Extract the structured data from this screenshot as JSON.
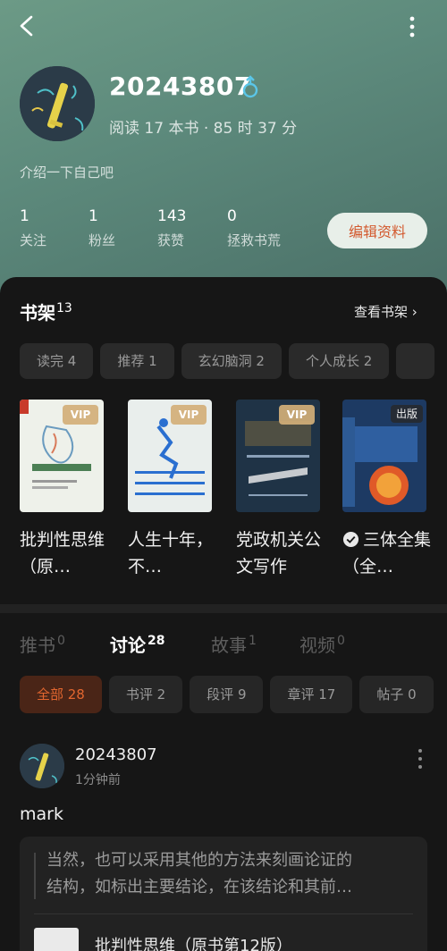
{
  "profile": {
    "username": "20243807",
    "reading_summary": "阅读 17 本书 · 85 时 37 分",
    "intro": "介绍一下自己吧",
    "stats": [
      {
        "value": "1",
        "label": "关注"
      },
      {
        "value": "1",
        "label": "粉丝"
      },
      {
        "value": "143",
        "label": "获赞"
      },
      {
        "value": "0",
        "label": "拯救书荒"
      }
    ],
    "edit_label": "编辑资料",
    "accent_color": "#d35a2f"
  },
  "shelf": {
    "title": "书架",
    "count": "13",
    "view_label": "查看书架 ›",
    "chips": [
      "读完 4",
      "推荐 1",
      "玄幻脑洞 2",
      "个人成长 2"
    ],
    "books": [
      {
        "title": "批判性思维（原…",
        "cover_color": "#eef1ea",
        "badge": "VIP"
      },
      {
        "title": "人生十年，不…",
        "cover_color": "#e9eeec",
        "badge": "VIP"
      },
      {
        "title": "党政机关公文写作",
        "cover_color": "#1f3346",
        "badge": "VIP"
      },
      {
        "title": "三体全集（全…",
        "cover_color": "#1d3a63",
        "badge": "出版"
      }
    ]
  },
  "tabs": [
    {
      "label": "推书",
      "count": "0"
    },
    {
      "label": "讨论",
      "count": "28"
    },
    {
      "label": "故事",
      "count": "1"
    },
    {
      "label": "视频",
      "count": "0"
    }
  ],
  "filters": [
    "全部 28",
    "书评 2",
    "段评 9",
    "章评 17",
    "帖子 0"
  ],
  "post": {
    "user": "20243807",
    "time": "1分钟前",
    "text": "mark",
    "quote_line1": "当然，也可以采用其他的方法来刻画论证的",
    "quote_line2": "结构，如标出主要结论，在该结论和其前…",
    "ref_title": "批判性思维（原书第12版）"
  }
}
